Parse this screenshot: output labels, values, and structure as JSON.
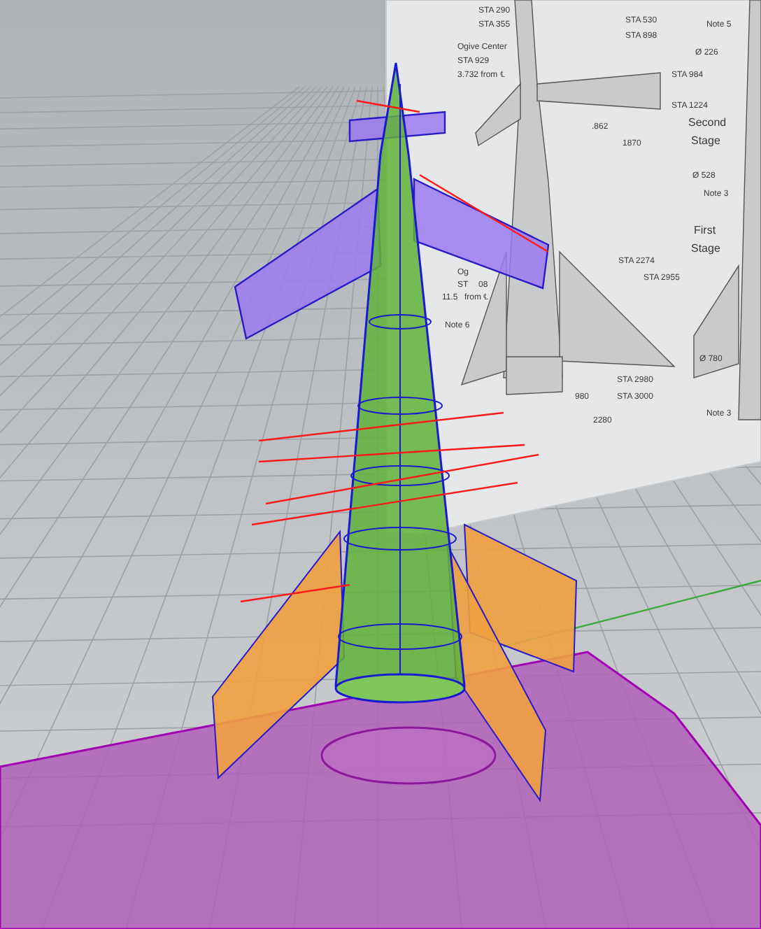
{
  "viewport": {
    "reference_drawing": {
      "labels": [
        {
          "text": "STA 290"
        },
        {
          "text": "STA 355"
        },
        {
          "text": "STA 530"
        },
        {
          "text": "STA 898"
        },
        {
          "text": "Note 5"
        },
        {
          "text": "Ogive Center"
        },
        {
          "text": "STA 929"
        },
        {
          "text": "3.732 from ℄"
        },
        {
          "text": "Ø 226"
        },
        {
          "text": "STA 984"
        },
        {
          "text": "STA 1224"
        },
        {
          "text": "Second"
        },
        {
          "text": "Stage"
        },
        {
          "text": ".862"
        },
        {
          "text": "1870"
        },
        {
          "text": "Ø 528"
        },
        {
          "text": "Note 3"
        },
        {
          "text": "First"
        },
        {
          "text": "Stage"
        },
        {
          "text": "STA 2274"
        },
        {
          "text": "STA 2955"
        },
        {
          "text": "Og"
        },
        {
          "text": "ST"
        },
        {
          "text": "08"
        },
        {
          "text": "11.5"
        },
        {
          "text": "from ℄"
        },
        {
          "text": "Note 6"
        },
        {
          "text": "Ø 780"
        },
        {
          "text": "STA 2980"
        },
        {
          "text": "STA 3000"
        },
        {
          "text": "980"
        },
        {
          "text": "2280"
        },
        {
          "text": "Note 3"
        }
      ]
    }
  }
}
